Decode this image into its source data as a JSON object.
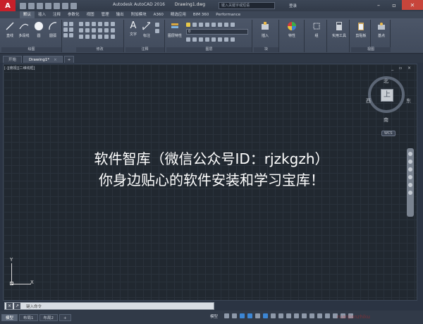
{
  "colors": {
    "drawing_bg": "#212830",
    "ribbon_bg": "#4c5668",
    "accent": "#c8202a",
    "status_on": "#3c86d4"
  },
  "titlebar": {
    "logo": "A",
    "app": "Autodesk AutoCAD 2016",
    "file": "Drawing1.dwg",
    "search_placeholder": "键入关键字或短语",
    "login": "登录"
  },
  "ribbon_tabs": [
    "默认",
    "插入",
    "注释",
    "参数化",
    "视图",
    "管理",
    "输出",
    "附加模块",
    "A360",
    "精选应用",
    "BIM 360",
    "Performance"
  ],
  "ribbon": {
    "draw": {
      "line": "直线",
      "polyline": "多段线",
      "circle": "圆",
      "arc": "圆弧",
      "label": "绘图"
    },
    "modify": {
      "label": "修改"
    },
    "annotation": {
      "text": "文字",
      "dimension": "标注",
      "label": "注释"
    },
    "layers": {
      "properties": "图层特性",
      "current": "0",
      "label": "图层"
    },
    "block": {
      "insert": "插入",
      "label": "块"
    },
    "properties": {
      "label": "特性"
    },
    "groups": {
      "label": "组"
    },
    "utilities": {
      "label": "实用工具"
    },
    "clipboard": {
      "label": "剪贴板"
    },
    "base": {
      "label": "基点"
    },
    "view": {
      "label": "视图"
    }
  },
  "doc_tabs": {
    "start": "开始",
    "drawing": "Drawing1*",
    "add": "+"
  },
  "viewport": {
    "label": "[-][俯视][二维线框]",
    "controls": "_ ▫ ×"
  },
  "viewcube": {
    "top": "上",
    "north": "北",
    "south": "南",
    "east": "东",
    "west": "西",
    "wcs": "WCS"
  },
  "overlay": {
    "line1": "软件智库（微信公众号ID：rjzkgzh）",
    "line2": "你身边贴心的软件安装和学习宝库！"
  },
  "ucs": {
    "x": "X",
    "y": "Y"
  },
  "command": {
    "prompt": "键入命令"
  },
  "layout_tabs": [
    "模型",
    "布局1",
    "布局2"
  ],
  "status": {
    "model": "模型"
  }
}
